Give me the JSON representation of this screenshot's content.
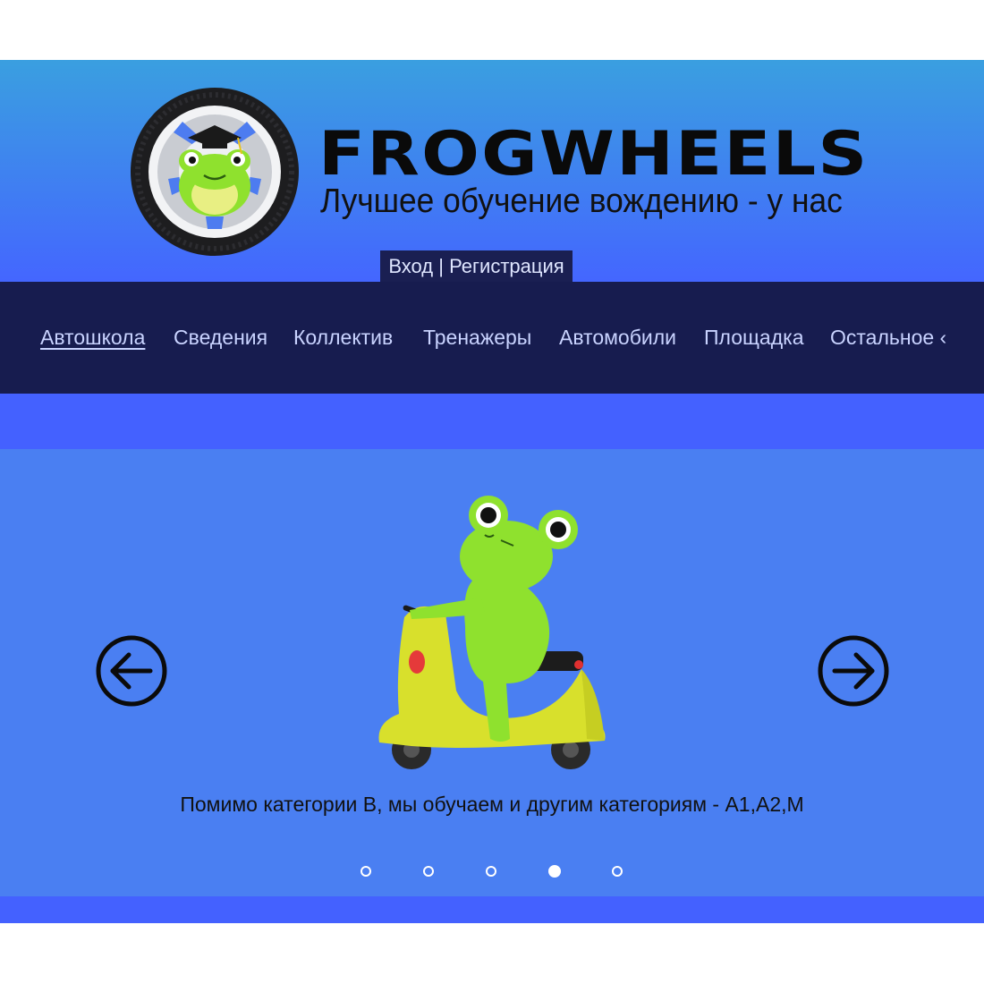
{
  "header": {
    "brand": "FROGWHEELS",
    "tagline": "Лучшее обучение вождению - у нас",
    "auth": {
      "login": "Вход",
      "separator": " | ",
      "register": "Регистрация"
    }
  },
  "nav": {
    "items": [
      {
        "label": "Автошкола",
        "active": true
      },
      {
        "label": "Сведения"
      },
      {
        "label": "Коллектив"
      },
      {
        "label": "Тренажеры"
      },
      {
        "label": "Автомобили"
      },
      {
        "label": "Площадка"
      },
      {
        "label": "Остальное ‹"
      }
    ]
  },
  "carousel": {
    "caption": "Помимо категории B, мы обучаем и другим категориям - A1,A2,M",
    "slide_count": 5,
    "active_slide": 4,
    "prev_icon": "arrow-left-circle-icon",
    "next_icon": "arrow-right-circle-icon"
  },
  "colors": {
    "header_top": "#3a9fe0",
    "header_bottom": "#4466ff",
    "nav_bg": "#171c4f",
    "carousel_bg": "#4a7ff2",
    "band": "#4461ff",
    "frog_green": "#8fe12e",
    "scooter_yellow": "#d8e02c"
  }
}
